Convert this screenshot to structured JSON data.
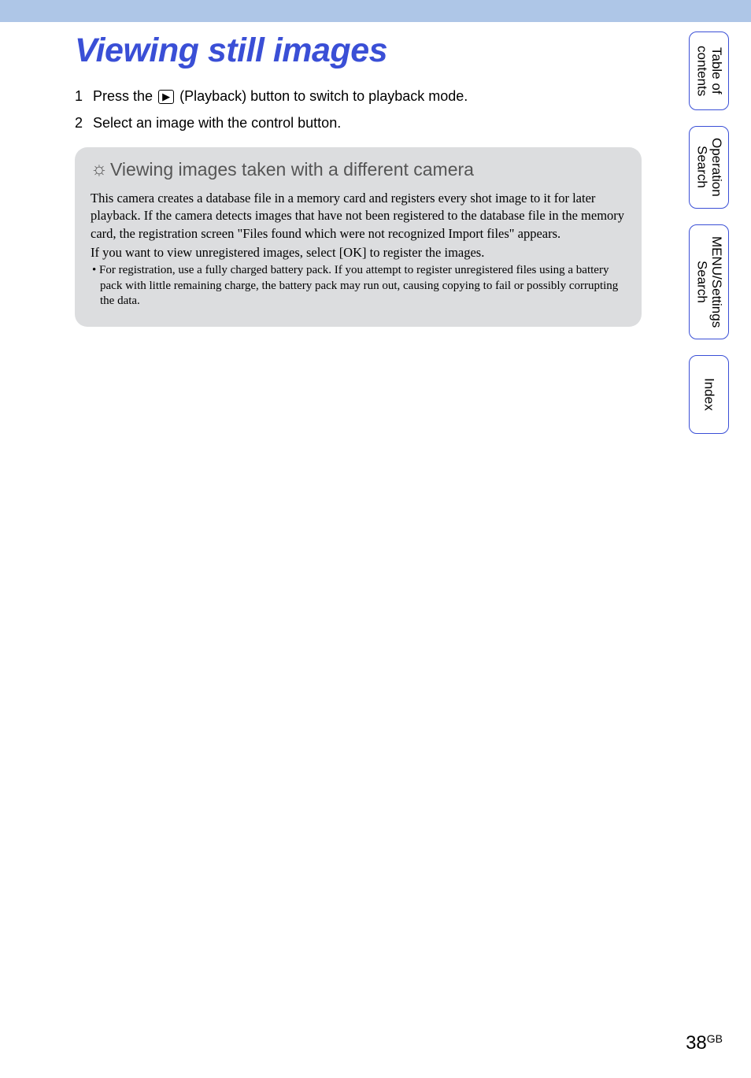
{
  "page": {
    "title": "Viewing still images",
    "number": "38",
    "lang": "GB"
  },
  "steps": [
    {
      "num": "1",
      "beforeIcon": "Press the ",
      "afterIcon": " (Playback) button to switch to playback mode."
    },
    {
      "num": "2",
      "beforeIcon": "Select an image with the control button.",
      "afterIcon": ""
    }
  ],
  "playback_icon_glyph": "▶",
  "tip_icon_glyph": "☼",
  "infobox": {
    "title": "Viewing images taken with a different camera",
    "para1": "This camera creates a database file in a memory card and registers every shot image to it for later playback. If the camera detects images that have not been registered to the database file in the memory card, the registration screen \"Files found which were not recognized Import files\" appears.",
    "para2": "If you want to view unregistered images, select [OK] to register the images.",
    "bullet": "For registration, use a fully charged battery pack. If you attempt to register unregistered files using a battery pack with little remaining charge, the battery pack may run out, causing copying to fail or possibly corrupting the data."
  },
  "sidetabs": {
    "toc": "Table of\ncontents",
    "operation": "Operation\nSearch",
    "menu": "MENU/Settings\nSearch",
    "index": "Index"
  }
}
